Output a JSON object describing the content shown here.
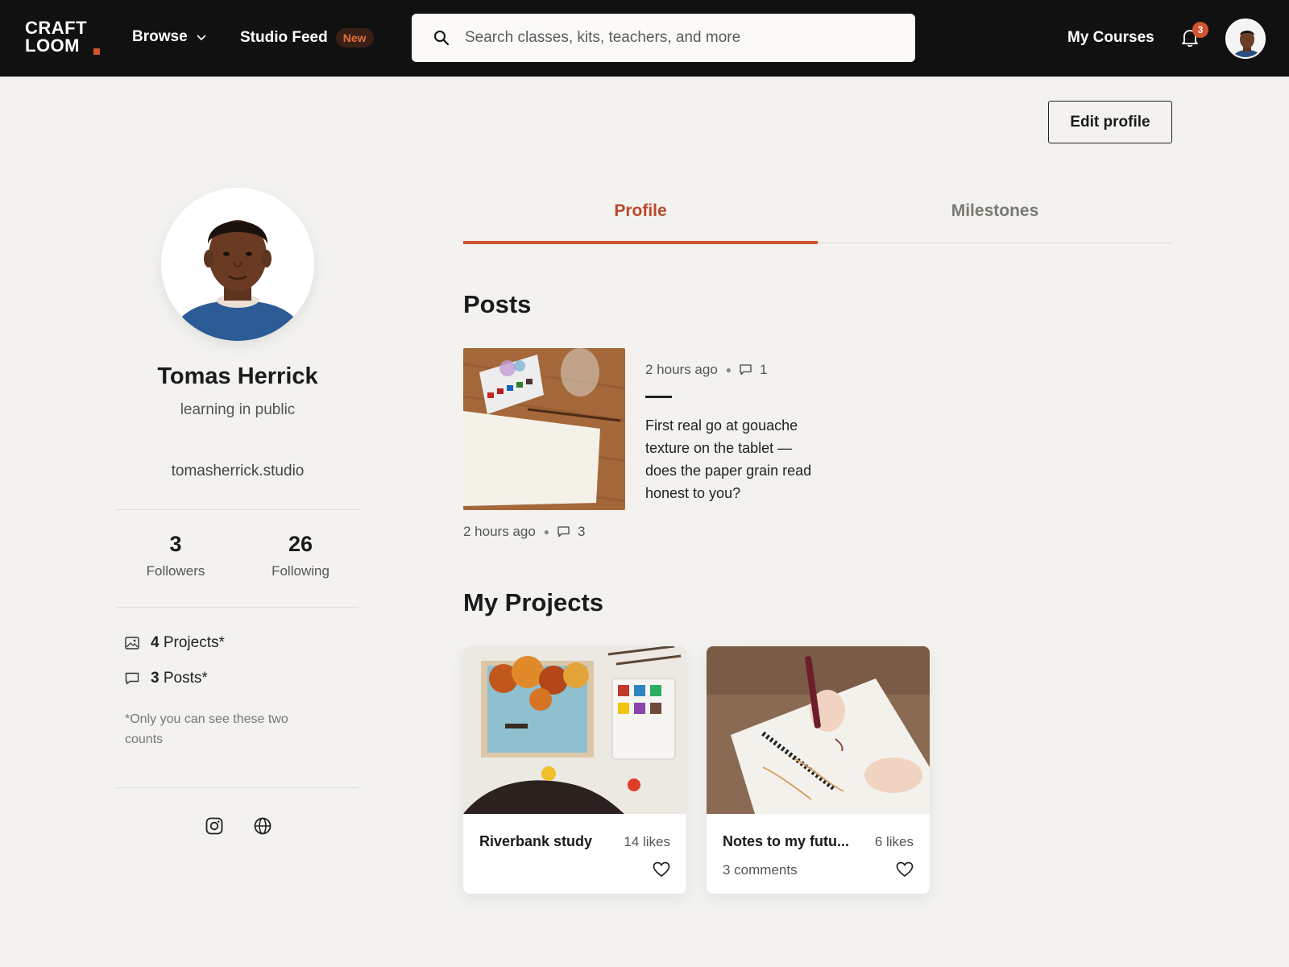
{
  "nav": {
    "logo_line1": "CRAFT",
    "logo_line2": "LOOM",
    "browse_label": "Browse",
    "feed_label": "Studio Feed",
    "feed_badge": "New",
    "search_placeholder": "Search classes, kits, teachers, and more",
    "my_courses_label": "My Courses",
    "notification_count": "3"
  },
  "actions": {
    "edit_profile_label": "Edit profile"
  },
  "profile": {
    "name": "Tomas Herrick",
    "tagline": "learning in public",
    "website": "tomasherrick.studio",
    "followers_count": "3",
    "followers_label": "Followers",
    "following_count": "26",
    "following_label": "Following",
    "projects_count": "4",
    "projects_label": "Projects*",
    "posts_count": "3",
    "posts_label": "Posts*",
    "footnote": "*Only you can see these two counts",
    "social_icons": [
      "instagram-icon",
      "globe-icon"
    ]
  },
  "tabs": [
    {
      "label": "Profile",
      "active": true
    },
    {
      "label": "Milestones",
      "active": false
    }
  ],
  "posts": {
    "title": "Posts",
    "items": [
      {
        "thumb_time": "2 hours ago",
        "thumb_comments": "3",
        "time": "2 hours ago",
        "comments": "1",
        "body": "First real go at gouache texture on the tablet — does the paper grain read honest to you?"
      }
    ]
  },
  "projects": {
    "title": "My Projects",
    "items": [
      {
        "title": "Riverbank study",
        "likes": "14 likes",
        "comments": ""
      },
      {
        "title": "Notes to my futu...",
        "likes": "6 likes",
        "comments": "3 comments"
      }
    ]
  },
  "colors": {
    "accent": "#d2532f",
    "accent_text": "#b84a2a",
    "nav_bg": "#111111",
    "page_bg": "#f3f2ef"
  }
}
